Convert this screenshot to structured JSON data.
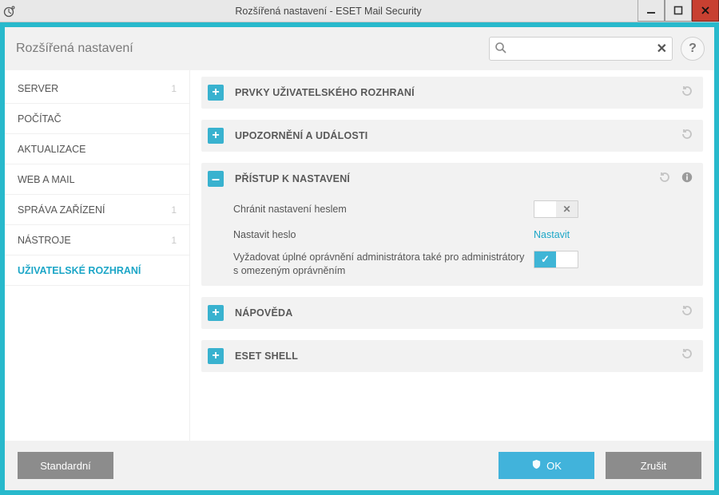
{
  "window": {
    "title": "Rozšířená nastavení - ESET Mail Security"
  },
  "header": {
    "title": "Rozšířená nastavení",
    "search_placeholder": "",
    "help_label": "?"
  },
  "sidebar": {
    "items": [
      {
        "label": "SERVER",
        "badge": "1"
      },
      {
        "label": "POČÍTAČ",
        "badge": ""
      },
      {
        "label": "AKTUALIZACE",
        "badge": ""
      },
      {
        "label": "WEB A MAIL",
        "badge": ""
      },
      {
        "label": "SPRÁVA ZAŘÍZENÍ",
        "badge": "1"
      },
      {
        "label": "NÁSTROJE",
        "badge": "1"
      },
      {
        "label": "UŽIVATELSKÉ ROZHRANÍ",
        "badge": ""
      }
    ]
  },
  "panels": {
    "ui_elements": {
      "title": "PRVKY UŽIVATELSKÉHO ROZHRANÍ"
    },
    "alerts": {
      "title": "UPOZORNĚNÍ A UDÁLOSTI"
    },
    "access": {
      "title": "PŘÍSTUP K NASTAVENÍ",
      "protect_label": "Chránit nastavení heslem",
      "setpw_label": "Nastavit heslo",
      "setpw_action": "Nastavit",
      "require_admin_label": "Vyžadovat úplné oprávnění administrátora také pro administrátory s omezeným oprávněním"
    },
    "help": {
      "title": "NÁPOVĚDA"
    },
    "shell": {
      "title": "ESET SHELL"
    }
  },
  "footer": {
    "default_label": "Standardní",
    "ok_label": "OK",
    "cancel_label": "Zrušit"
  }
}
